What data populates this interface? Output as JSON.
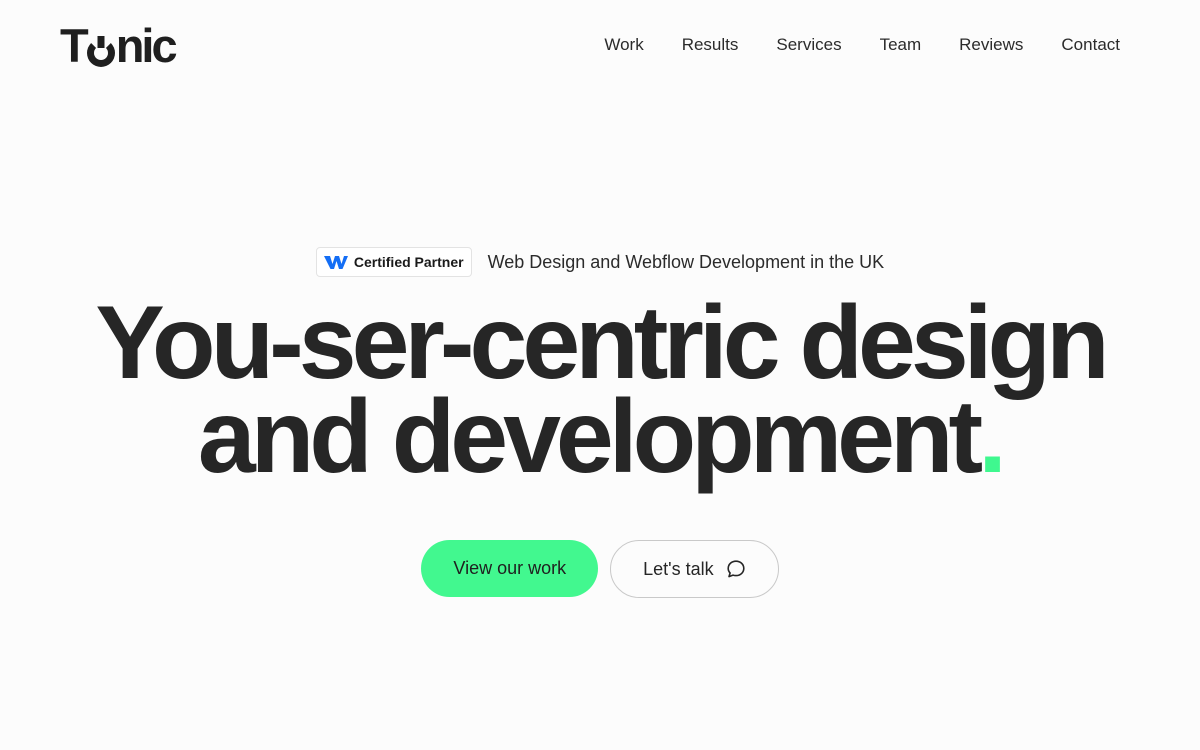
{
  "brand": {
    "logo_prefix": "T",
    "logo_suffix": "nic",
    "accent_color": "#42f88f"
  },
  "nav": {
    "items": [
      {
        "label": "Work"
      },
      {
        "label": "Results"
      },
      {
        "label": "Services"
      },
      {
        "label": "Team"
      },
      {
        "label": "Reviews"
      },
      {
        "label": "Contact"
      }
    ]
  },
  "hero": {
    "badge": {
      "icon": "webflow-logo-icon",
      "label": "Certified Partner"
    },
    "tagline": "Web Design and Webflow Development in the UK",
    "headline_line1": "You-ser-centric design",
    "headline_line2": "and development",
    "headline_dot": ".",
    "primary_cta": "View our work",
    "secondary_cta": "Let's talk",
    "secondary_cta_icon": "chat-bubble-icon"
  }
}
